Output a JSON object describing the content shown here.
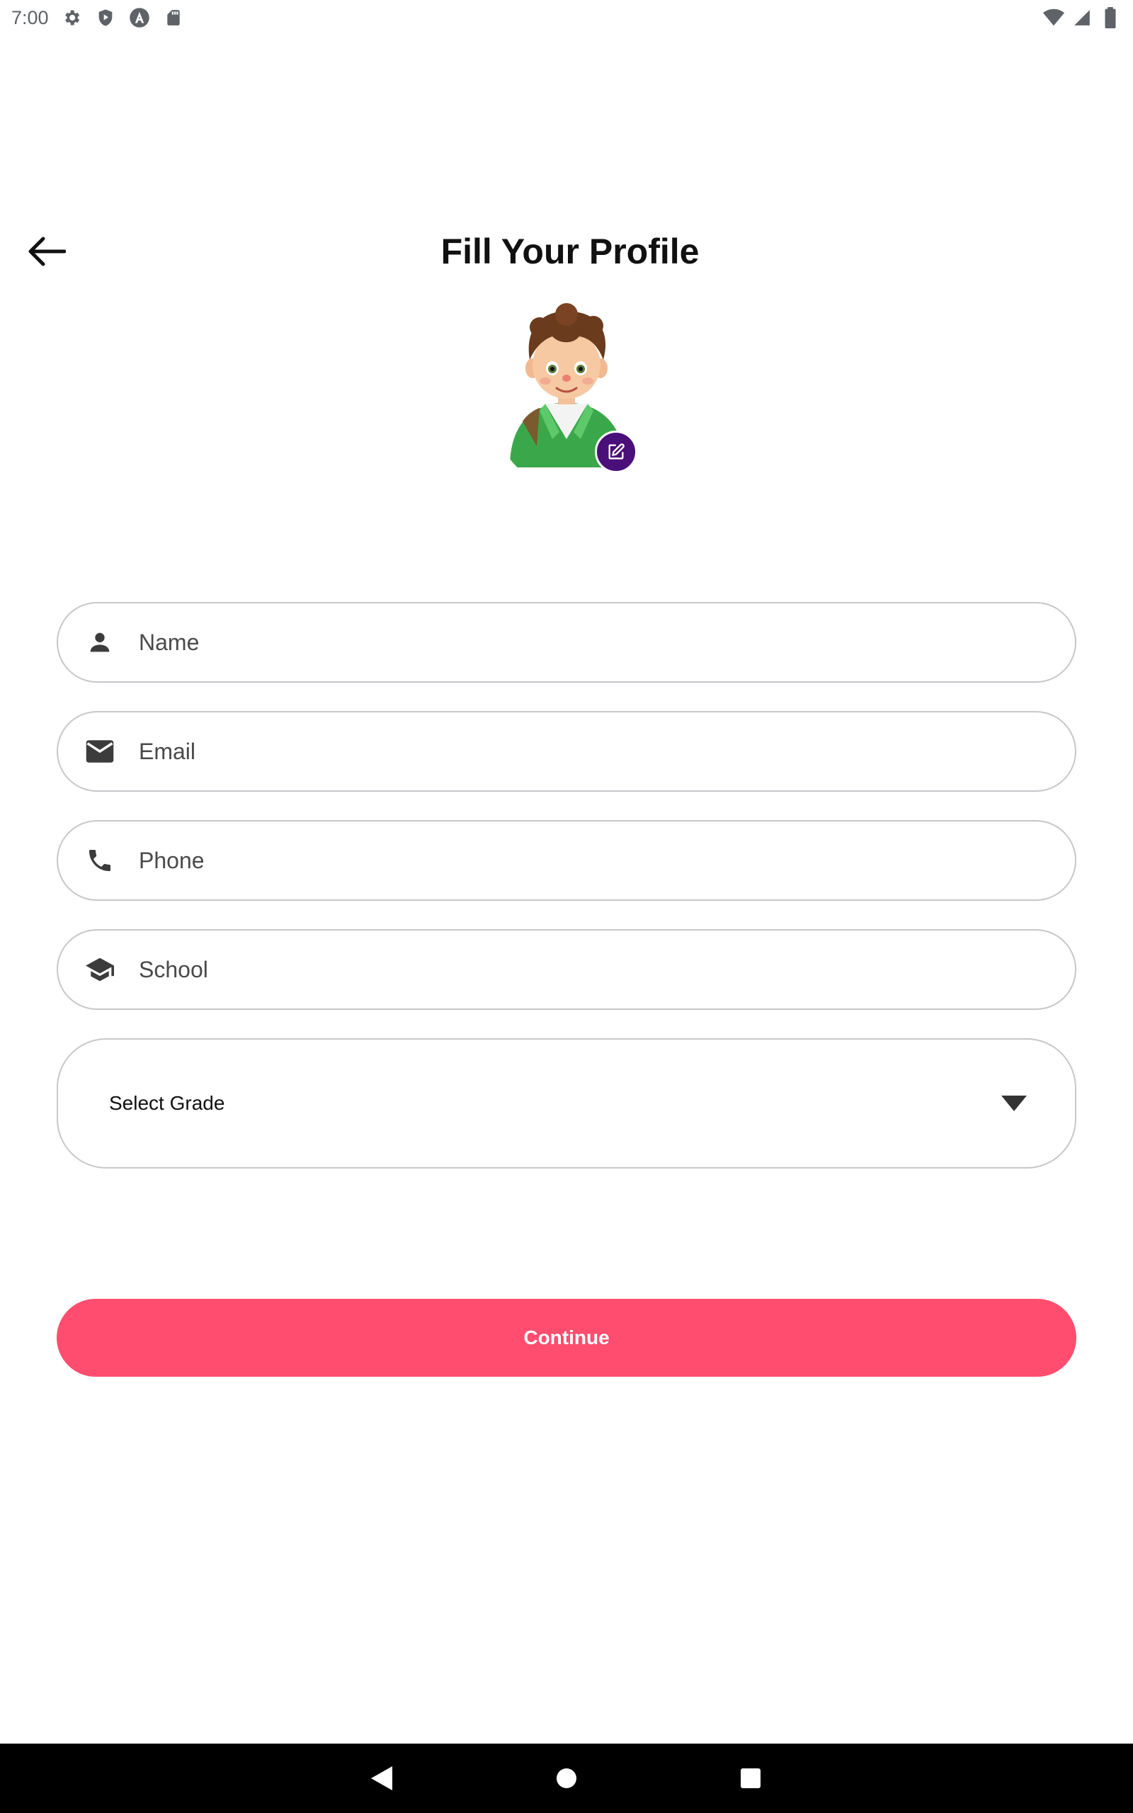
{
  "status_bar": {
    "time": "7:00",
    "left_icons": [
      "settings-icon",
      "shield-play-icon",
      "a-circle-icon",
      "sd-card-icon"
    ],
    "right_icons": [
      "wifi-icon",
      "signal-icon",
      "battery-icon"
    ]
  },
  "header": {
    "title": "Fill Your Profile",
    "back_icon": "arrow-left-icon"
  },
  "avatar": {
    "edit_icon": "edit-icon",
    "edit_color": "#4b0f7a"
  },
  "form": {
    "name": {
      "placeholder": "Name",
      "icon": "person-icon"
    },
    "email": {
      "placeholder": "Email",
      "icon": "mail-icon"
    },
    "phone": {
      "placeholder": "Phone",
      "icon": "phone-icon"
    },
    "school": {
      "placeholder": "School",
      "icon": "school-icon"
    },
    "grade": {
      "label": "Select Grade",
      "icon": "dropdown-arrow-icon"
    }
  },
  "continue_button": {
    "label": "Continue",
    "color": "#ff4d6f"
  },
  "nav_bar": {
    "buttons": [
      "back-triangle-icon",
      "home-circle-icon",
      "recents-square-icon"
    ]
  }
}
